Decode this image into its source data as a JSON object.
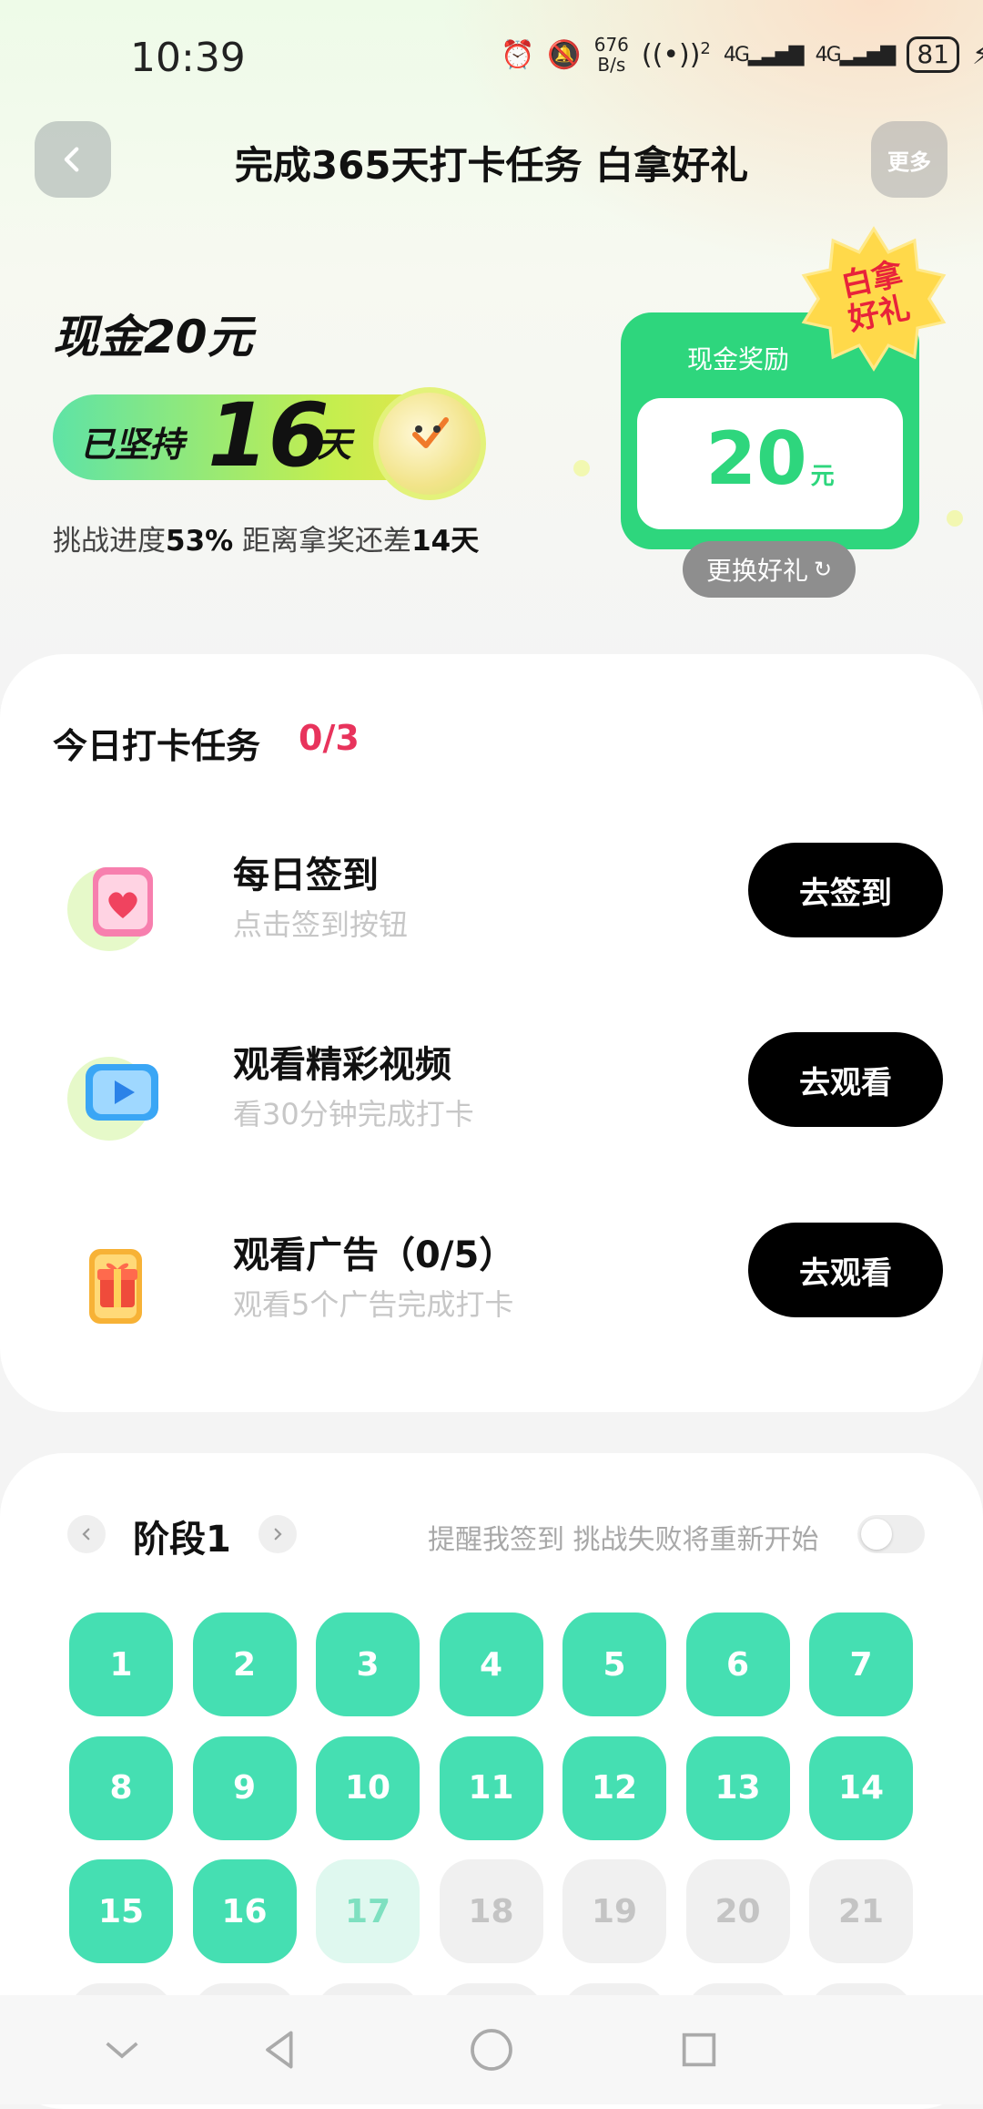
{
  "status_bar": {
    "time": "10:39",
    "net_rate_value": "676",
    "net_rate_unit": "B/s",
    "wifi_sup": "2",
    "sim1": "4G",
    "sim2": "4G",
    "battery": "81"
  },
  "header": {
    "title": "完成365天打卡任务 白拿好礼",
    "more_label": "更多"
  },
  "hero": {
    "reward_title": "现金20元",
    "streak_prefix": "已坚持",
    "streak_days": "16",
    "streak_unit": "天",
    "progress_prefix": "挑战进度",
    "progress_percent": "53%",
    "progress_middle": " 距离拿奖还差",
    "days_remaining": "14天"
  },
  "reward_card": {
    "label": "现金奖励",
    "amount": "20",
    "unit": "元",
    "badge_line1": "白拿",
    "badge_line2": "好礼",
    "swap_label": "更换好礼"
  },
  "tasks": {
    "heading": "今日打卡任务",
    "count": "0/3",
    "items": [
      {
        "title": "每日签到",
        "subtitle": "点击签到按钮",
        "button": "去签到",
        "icon": "calendar-heart-icon"
      },
      {
        "title": "观看精彩视频",
        "subtitle": "看30分钟完成打卡",
        "button": "去观看",
        "icon": "video-play-icon"
      },
      {
        "title": "观看广告（0/5）",
        "subtitle": "观看5个广告完成打卡",
        "button": "去观看",
        "icon": "gift-box-icon"
      }
    ]
  },
  "calendar": {
    "stage_label": "阶段1",
    "remind_text": "提醒我签到 挑战失败将重新开始",
    "remind_enabled": false,
    "days": [
      {
        "n": "1",
        "s": "done"
      },
      {
        "n": "2",
        "s": "done"
      },
      {
        "n": "3",
        "s": "done"
      },
      {
        "n": "4",
        "s": "done"
      },
      {
        "n": "5",
        "s": "done"
      },
      {
        "n": "6",
        "s": "done"
      },
      {
        "n": "7",
        "s": "done"
      },
      {
        "n": "8",
        "s": "done"
      },
      {
        "n": "9",
        "s": "done"
      },
      {
        "n": "10",
        "s": "done"
      },
      {
        "n": "11",
        "s": "done"
      },
      {
        "n": "12",
        "s": "done"
      },
      {
        "n": "13",
        "s": "done"
      },
      {
        "n": "14",
        "s": "done"
      },
      {
        "n": "15",
        "s": "done"
      },
      {
        "n": "16",
        "s": "done"
      },
      {
        "n": "17",
        "s": "today"
      },
      {
        "n": "18",
        "s": "future"
      },
      {
        "n": "19",
        "s": "future"
      },
      {
        "n": "20",
        "s": "future"
      },
      {
        "n": "21",
        "s": "future"
      }
    ]
  },
  "colors": {
    "accent_green": "#2ed67d",
    "day_done": "#45dfb2",
    "count_red": "#e8335c",
    "button_black": "#000000"
  }
}
